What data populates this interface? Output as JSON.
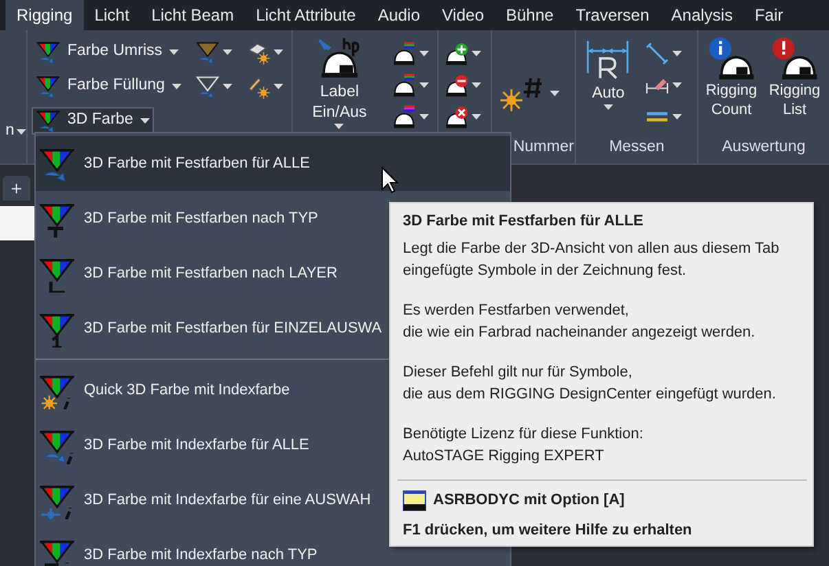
{
  "tabs": [
    {
      "label": "Rigging",
      "selected": true
    },
    {
      "label": "Licht",
      "selected": false
    },
    {
      "label": "Licht Beam",
      "selected": false
    },
    {
      "label": "Licht Attribute",
      "selected": false
    },
    {
      "label": "Audio",
      "selected": false
    },
    {
      "label": "Video",
      "selected": false
    },
    {
      "label": "Bühne",
      "selected": false
    },
    {
      "label": "Traversen",
      "selected": false
    },
    {
      "label": "Analysis",
      "selected": false
    },
    {
      "label": "Fair",
      "selected": false
    }
  ],
  "ribbon": {
    "cut_group": {
      "text": "n"
    },
    "color_group": {
      "buttons": [
        {
          "label": "Farbe Umriss",
          "expanded": false
        },
        {
          "label": "Farbe Füllung",
          "expanded": false
        },
        {
          "label": "3D Farbe",
          "expanded": true
        }
      ]
    },
    "label_group": {
      "button": "Label Ein/Aus"
    },
    "nummer_group": {
      "label": "Nummer"
    },
    "messen_group": {
      "button": "Auto",
      "label": "Messen"
    },
    "auswertung_group": {
      "buttons": [
        "Rigging Count",
        "Rigging List"
      ],
      "label": "Auswertung"
    }
  },
  "document_tabs": {
    "add": "+"
  },
  "menu": {
    "sections": [
      [
        {
          "label": "3D Farbe mit Festfarben für ALLE",
          "selected": true
        },
        {
          "label": "3D Farbe mit Festfarben nach TYP",
          "selected": false
        },
        {
          "label": "3D Farbe mit Festfarben nach LAYER",
          "selected": false
        },
        {
          "label": "3D Farbe mit Festfarben für EINZELAUSWA",
          "selected": false
        }
      ],
      [
        {
          "label": "Quick 3D Farbe mit Indexfarbe",
          "selected": false
        },
        {
          "label": "3D Farbe mit Indexfarbe für ALLE",
          "selected": false
        },
        {
          "label": "3D Farbe mit Indexfarbe für eine AUSWAH",
          "selected": false
        },
        {
          "label": "3D Farbe mit Indexfarbe nach TYP",
          "selected": false
        }
      ]
    ]
  },
  "tooltip": {
    "title": "3D Farbe mit Festfarben für ALLE",
    "paragraphs": [
      "Legt die Farbe der 3D-Ansicht von allen aus diesem Tab\neingefügte Symbole in der Zeichnung fest.",
      "Es werden Festfarben verwendet,\ndie wie ein Farbrad nacheinander angezeigt werden.",
      "Dieser Befehl gilt nur für Symbole,\ndie aus dem RIGGING DesignCenter eingefügt wurden.",
      "Benötigte Lizenz für diese Funktion:\nAutoSTAGE Rigging EXPERT"
    ],
    "command": "ASRBODYC mit Option [A]",
    "help": "F1 drücken, um weitere Hilfe zu erhalten"
  }
}
